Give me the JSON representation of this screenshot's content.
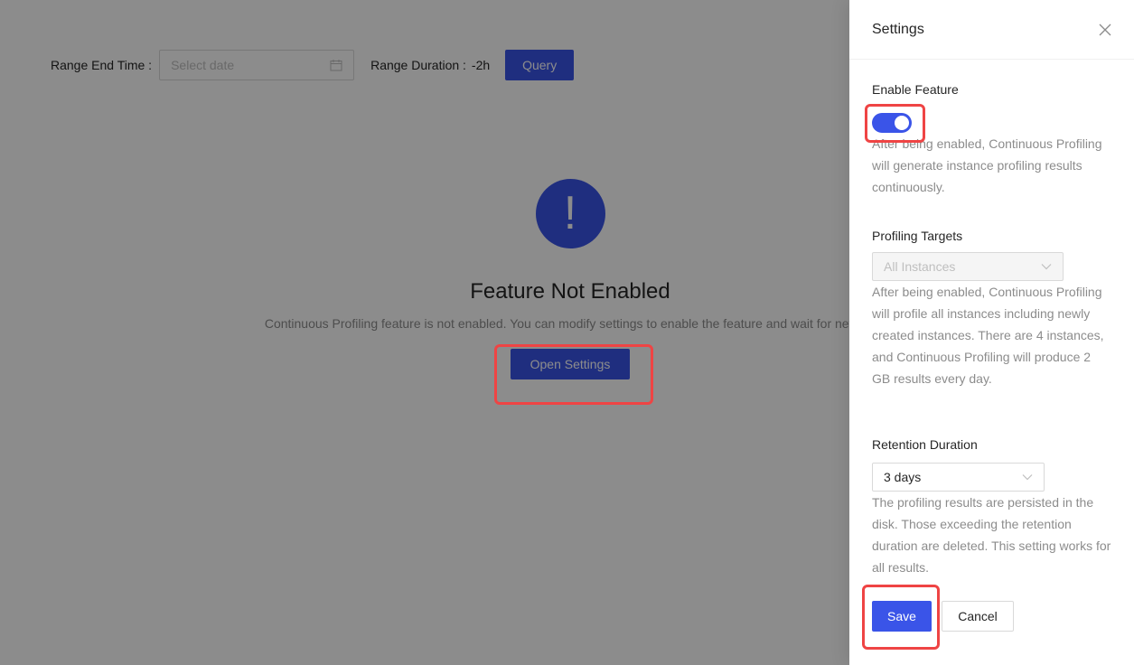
{
  "toolbar": {
    "range_end_label": "Range End Time",
    "date_placeholder": "Select date",
    "duration_label": "Range Duration",
    "duration_value": "-2h",
    "query_label": "Query"
  },
  "result": {
    "icon": "!",
    "title": "Feature Not Enabled",
    "subtitle": "Continuous Profiling feature is not enabled. You can modify settings to enable the feature and wait for new da",
    "open_settings_label": "Open Settings"
  },
  "drawer": {
    "title": "Settings",
    "enable_feature": {
      "label": "Enable Feature",
      "enabled": true,
      "help": "After being enabled, Continuous Profiling will generate instance profiling results continuously."
    },
    "profiling_targets": {
      "label": "Profiling Targets",
      "value": "All Instances",
      "help": "After being enabled, Continuous Profiling will profile all instances including newly created instances. There are 4 instances, and Continuous Profiling will produce 2 GB results every day."
    },
    "retention_duration": {
      "label": "Retention Duration",
      "value": "3 days",
      "help": "The profiling results are persisted in the disk. Those exceeding the retention duration are deleted. This setting works for all results."
    },
    "save_label": "Save",
    "cancel_label": "Cancel"
  },
  "colors": {
    "primary": "#3a54e8",
    "highlight": "#ef4444"
  }
}
